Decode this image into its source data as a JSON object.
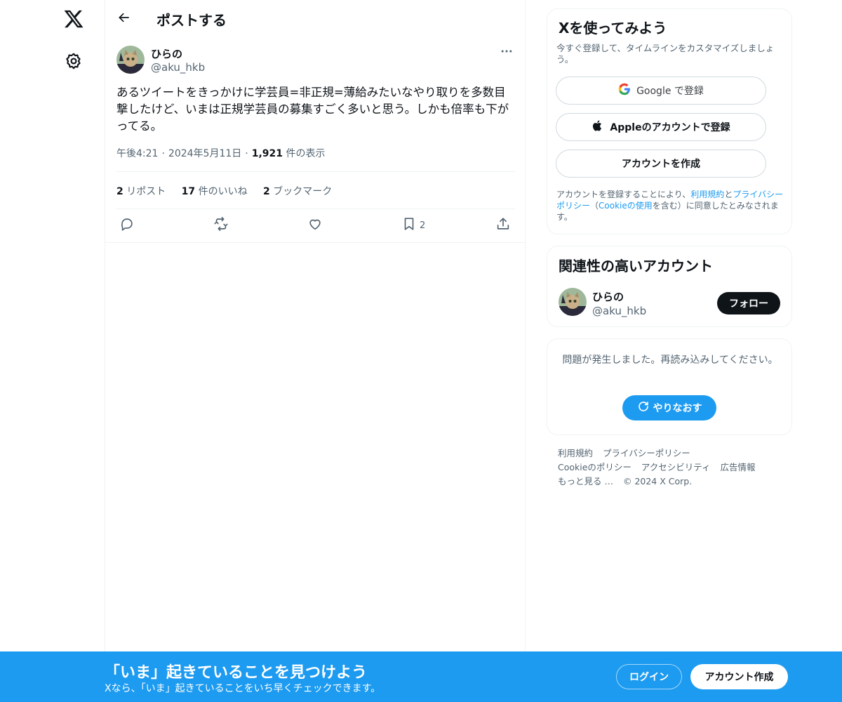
{
  "colors": {
    "accent": "#1d9bf0",
    "text": "#0f1419",
    "muted": "#536471",
    "border": "#eff3f4"
  },
  "nav": {
    "logo_icon": "x-logo-icon",
    "settings_icon": "gear-icon"
  },
  "header": {
    "title": "ポストする",
    "back_icon": "arrow-left-icon"
  },
  "post": {
    "author_name": "ひらの",
    "author_handle": "@aku_hkb",
    "text": "あるツイートをきっかけに学芸員=非正規=薄給みたいなやり取りを多数目撃したけど、いまは正規学芸員の募集すごく多いと思う。しかも倍率も下がってる。",
    "time": "午後4:21",
    "date": "2024年5月11日",
    "views_count": "1,921",
    "views_label": "件の表示",
    "stats": {
      "reposts_count": "2",
      "reposts_label": "リポスト",
      "likes_count": "17",
      "likes_label": "件のいいね",
      "bookmarks_count": "2",
      "bookmarks_label": "ブックマーク"
    },
    "actions": {
      "reply_icon": "reply-icon",
      "repost_icon": "repost-icon",
      "like_icon": "heart-icon",
      "bookmark_icon": "bookmark-icon",
      "bookmark_count": "2",
      "share_icon": "share-icon"
    }
  },
  "sidebar": {
    "signup_card": {
      "title": "Xを使ってみよう",
      "description": "今すぐ登録して、タイムラインをカスタマイズしましょう。",
      "google_label": "Google で登録",
      "apple_label": "Appleのアカウントで登録",
      "create_label": "アカウントを作成",
      "legal_prefix": "アカウントを登録することにより、",
      "legal_terms": "利用規約",
      "legal_and": "と",
      "legal_privacy": "プライバシーポリシー",
      "legal_open": "（",
      "legal_cookie": "Cookieの使用",
      "legal_suffix": "を含む）に同意したとみなされます。"
    },
    "related": {
      "title": "関連性の高いアカウント",
      "name": "ひらの",
      "handle": "@aku_hkb",
      "follow_label": "フォロー"
    },
    "error_card": {
      "message": "問題が発生しました。再読み込みしてください。",
      "retry_label": "やりなおす"
    },
    "footer": {
      "terms": "利用規約",
      "privacy": "プライバシーポリシー",
      "cookie": "Cookieのポリシー",
      "accessibility": "アクセシビリティ",
      "ads": "広告情報",
      "more": "もっと見る …",
      "copyright": "© 2024 X Corp."
    }
  },
  "bottom_bar": {
    "title": "「いま」起きていることを見つけよう",
    "subtitle": "Xなら、「いま」起きていることをいち早くチェックできます。",
    "login_label": "ログイン",
    "signup_label": "アカウント作成"
  }
}
